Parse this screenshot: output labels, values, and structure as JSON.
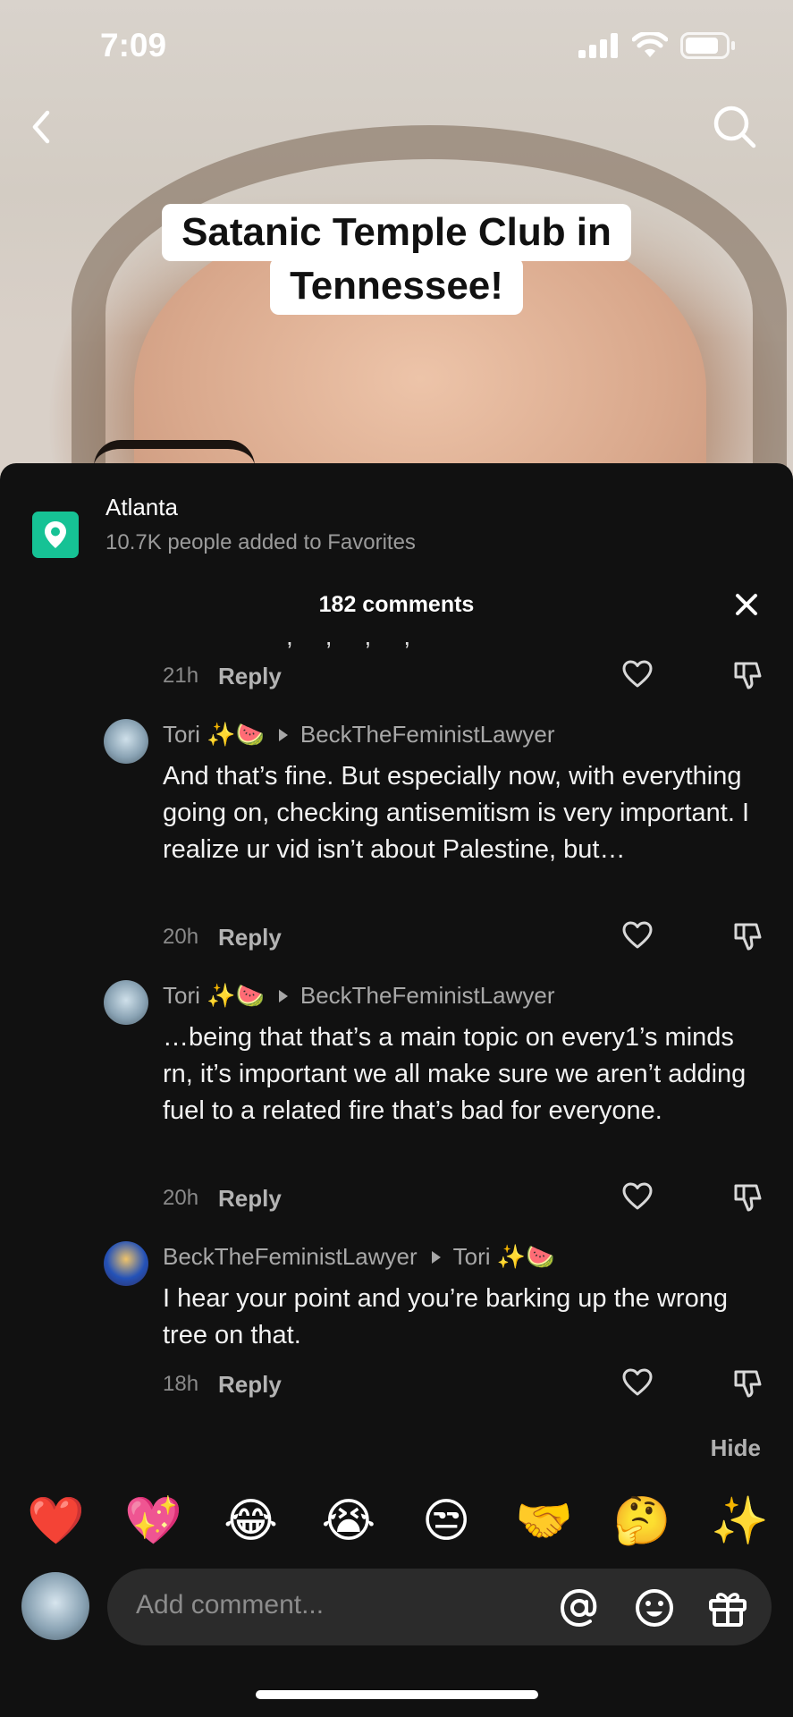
{
  "status": {
    "time": "7:09"
  },
  "video": {
    "caption_line1": "Satanic Temple Club in",
    "caption_line2": "Tennessee!"
  },
  "place": {
    "name": "Atlanta",
    "favorites": "10.7K people added to Favorites"
  },
  "comments_header": {
    "title": "182 comments"
  },
  "first_row": {
    "age": "21h",
    "reply": "Reply"
  },
  "comments": [
    {
      "author": "Tori ✨🍉",
      "reply_to": "BeckTheFeministLawyer",
      "text": "And that’s fine. But especially now, with everything going on, checking antisemitism is very important. I realize ur vid isn’t about Palestine, but…",
      "age": "20h",
      "reply": "Reply"
    },
    {
      "author": "Tori ✨🍉",
      "reply_to": "BeckTheFeministLawyer",
      "text": "…being that that’s a main topic on every1’s minds rn, it’s important we all make sure we aren’t adding fuel to a related fire that’s bad for everyone.",
      "age": "20h",
      "reply": "Reply"
    },
    {
      "author": "BeckTheFeministLawyer",
      "reply_to": "Tori ✨🍉",
      "text": "I hear your point and you’re barking up the wrong tree on that.",
      "age": "18h",
      "reply": "Reply"
    }
  ],
  "hide_label": "Hide",
  "quick_emojis": [
    "❤️",
    "💖",
    "😂",
    "😭",
    "😒",
    "🤝",
    "🤔",
    "✨"
  ],
  "composer": {
    "placeholder": "Add comment..."
  },
  "colors": {
    "pin_green": "#16c295",
    "sheet_bg": "#111111",
    "field_bg": "#2b2b2b"
  },
  "icons": [
    "back-icon",
    "search-icon",
    "location-pin-icon",
    "close-icon",
    "heart-icon",
    "dislike-icon",
    "mention-icon",
    "emoji-icon",
    "gift-icon"
  ]
}
